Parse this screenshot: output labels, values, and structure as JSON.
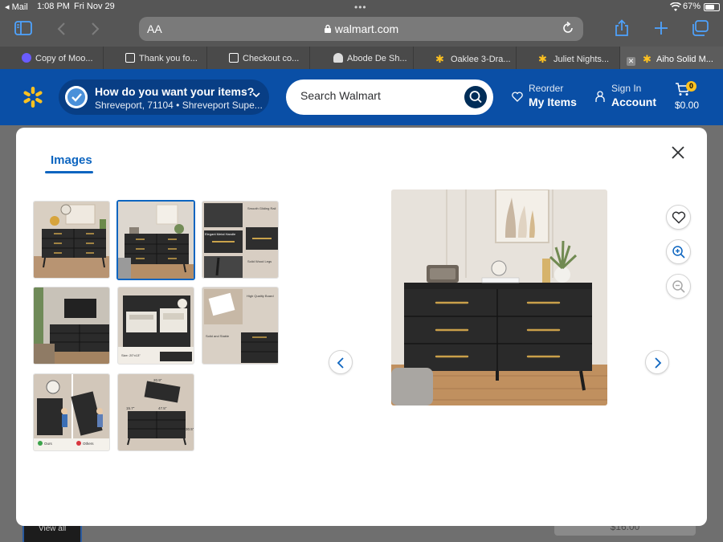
{
  "status_bar": {
    "back_app": "◂ Mail",
    "time": "1:08 PM",
    "date": "Fri Nov 29",
    "battery": "67%"
  },
  "browser": {
    "text_size_label": "AA",
    "url": "walmart.com",
    "tabs": [
      {
        "label": "Copy of Moo...",
        "icon_color": "#6a5cff"
      },
      {
        "label": "Thank you fo...",
        "icon_color": "#ffffff"
      },
      {
        "label": "Checkout co...",
        "icon_color": "#ffffff"
      },
      {
        "label": "Abode De Sh...",
        "icon_color": "#ffffff"
      },
      {
        "label": "Oaklee 3-Dra...",
        "icon_color": "#ffc220"
      },
      {
        "label": "Juliet Nights...",
        "icon_color": "#ffc220"
      },
      {
        "label": "Aiho Solid M...",
        "icon_color": "#ffc220"
      }
    ]
  },
  "walmart_header": {
    "delivery_title": "How do you want your items?",
    "delivery_location": "Shreveport, 71104 • Shreveport Supe...",
    "search_placeholder": "Search Walmart",
    "reorder_line1": "Reorder",
    "reorder_line2": "My Items",
    "signin_line1": "Sign In",
    "signin_line2": "Account",
    "cart_count": "0",
    "cart_total": "$0.00",
    "brand_color": "#0a4fa6",
    "accent_color": "#ffc220"
  },
  "background_page": {
    "view_all": "View all",
    "price_hint": "$16.00"
  },
  "modal": {
    "tab_label": "Images",
    "selected_index": 1,
    "thumbnails": [
      {
        "name": "dresser-living-room"
      },
      {
        "name": "dresser-with-lamp"
      },
      {
        "name": "dresser-features"
      },
      {
        "name": "dresser-with-tv"
      },
      {
        "name": "dresser-drawers-open"
      },
      {
        "name": "dresser-quality-board"
      },
      {
        "name": "dresser-anti-tipping"
      },
      {
        "name": "dresser-dimensions"
      }
    ],
    "thumb_texts": {
      "feat1": "Smooth Gliding Rail",
      "feat2": "Elegant Metal Handle",
      "feat3": "Solid Wood Legs",
      "quality1": "High Quality Board",
      "quality2": "Solid and Stable",
      "size": "Size: 20\"x13\"",
      "dim_w": "47.5\"",
      "dim_d": "15.7\"",
      "dim_h": "30.5\"",
      "dim_top": "20.9\"",
      "ours": "Ours",
      "others": "Others"
    }
  }
}
